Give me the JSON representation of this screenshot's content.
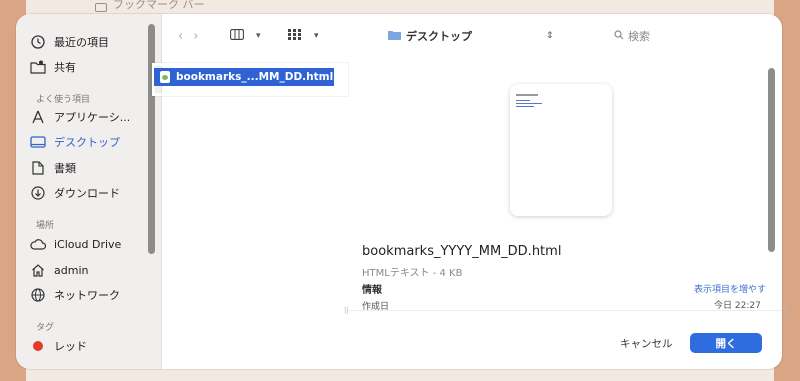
{
  "background": {
    "window_title": "ブックマーク バー"
  },
  "sidebar": {
    "items": [
      {
        "label": "最近の項目",
        "icon": "clock-icon"
      },
      {
        "label": "共有",
        "icon": "shared-folder-icon"
      }
    ],
    "favorites_heading": "よく使う項目",
    "favorites": [
      {
        "label": "アプリケーシ...",
        "icon": "applications-icon"
      },
      {
        "label": "デスクトップ",
        "icon": "desktop-icon",
        "active": true
      },
      {
        "label": "書類",
        "icon": "document-icon"
      },
      {
        "label": "ダウンロード",
        "icon": "download-icon"
      }
    ],
    "locations_heading": "場所",
    "locations": [
      {
        "label": "iCloud Drive",
        "icon": "cloud-icon"
      },
      {
        "label": "admin",
        "icon": "home-icon"
      },
      {
        "label": "ネットワーク",
        "icon": "globe-icon"
      }
    ],
    "tags_heading": "タグ",
    "tags": [
      {
        "label": "レッド",
        "color": "#e33a2f"
      }
    ]
  },
  "toolbar": {
    "path": "デスクトップ",
    "search_placeholder": "検索"
  },
  "file_list": {
    "selected_file": "bookmarks_...MM_DD.html"
  },
  "preview": {
    "filename": "bookmarks_YYYY_MM_DD.html",
    "kind": "HTMLテキスト - 4 KB",
    "info_label": "情報",
    "show_more": "表示項目を増やす",
    "created_label": "作成日",
    "created_value": "今日 22:27"
  },
  "buttons": {
    "cancel": "キャンセル",
    "open": "開く"
  },
  "colors": {
    "accent": "#2f6ce0",
    "selection": "#2f63d4",
    "tag_red": "#e33a2f"
  }
}
